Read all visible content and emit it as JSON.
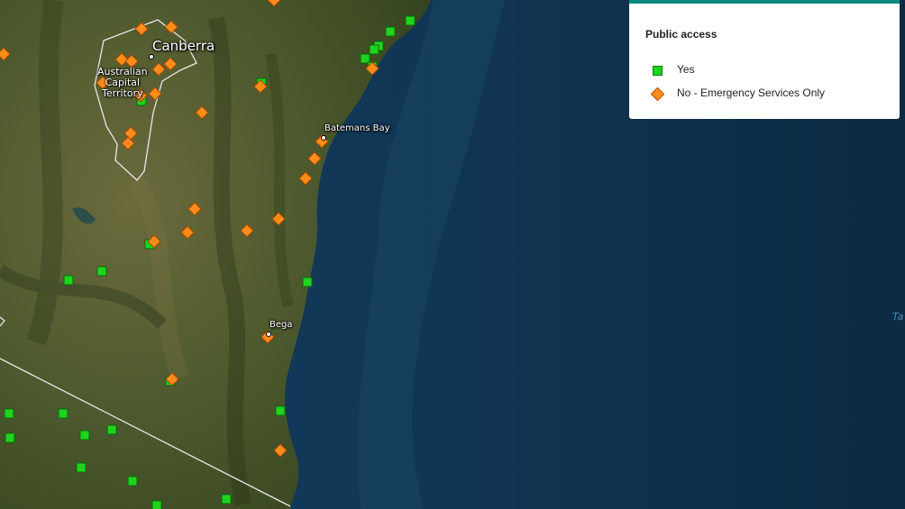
{
  "map": {
    "places": {
      "canberra": "Canberra",
      "act": [
        "Australian",
        "Capital",
        "Territory"
      ],
      "batemans_bay": "Batemans Bay",
      "bega": "Bega",
      "tasman_fragment": "Ta"
    }
  },
  "legend": {
    "title": "Public access",
    "items": [
      {
        "label": "Yes",
        "symbol": "green-square",
        "color": "#1ed41e"
      },
      {
        "label": "No - Emergency Services Only",
        "symbol": "orange-diamond",
        "color": "#ff8c1a"
      }
    ]
  },
  "colors": {
    "ocean_deep": "#0e2e44",
    "ocean_shallow": "#2f6f8f",
    "land": "#4b5a2c",
    "legend_accent": "#0c8a80"
  }
}
